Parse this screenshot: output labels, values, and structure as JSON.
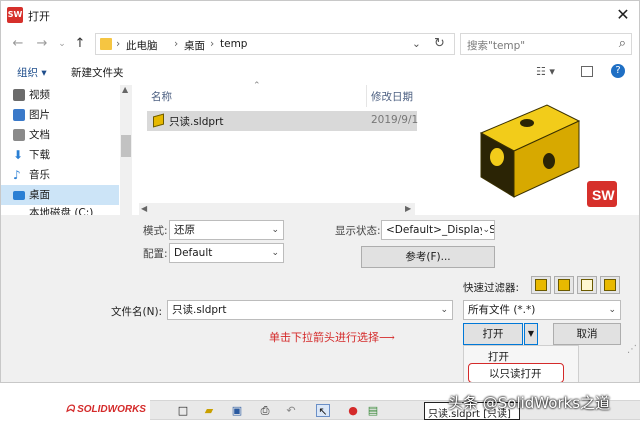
{
  "window": {
    "title": "打开",
    "app_icon": "SW"
  },
  "address": {
    "breadcrumb": [
      "此电脑",
      "桌面",
      "temp"
    ],
    "separator": "›"
  },
  "search": {
    "placeholder": "搜索\"temp\""
  },
  "toolbar": {
    "organize": "组织 ▾",
    "new_folder": "新建文件夹"
  },
  "sidebar": {
    "items": [
      {
        "label": "视频",
        "icon": "video-icon",
        "color": "#6b6b6b"
      },
      {
        "label": "图片",
        "icon": "pictures-icon",
        "color": "#3a79c9"
      },
      {
        "label": "文档",
        "icon": "documents-icon",
        "color": "#8a8a8a"
      },
      {
        "label": "下载",
        "icon": "download-icon",
        "color": "#2a7fd4"
      },
      {
        "label": "音乐",
        "icon": "music-icon",
        "color": "#2a7fd4"
      },
      {
        "label": "桌面",
        "icon": "desktop-icon",
        "color": "#2a7fd4"
      },
      {
        "label": "本地磁盘 (C:)",
        "icon": "drive-icon",
        "color": "#777777"
      }
    ],
    "selected": "桌面"
  },
  "file_list": {
    "columns": {
      "name": "名称",
      "date": "修改日期"
    },
    "rows": [
      {
        "name": "只读.sldprt",
        "date": "2019/9/1"
      }
    ]
  },
  "options": {
    "mode_label": "模式:",
    "mode_value": "还原",
    "config_label": "配置:",
    "config_value": "Default",
    "display_label": "显示状态:",
    "display_value": "<Default>_Display S",
    "references_button": "参考(F)...",
    "quick_filter_label": "快速过滤器:"
  },
  "filename": {
    "label": "文件名(N):",
    "value": "只读.sldprt",
    "type_value": "所有文件 (*.*)"
  },
  "buttons": {
    "open": "打开",
    "cancel": "取消"
  },
  "dropdown_menu": {
    "items": [
      "打开",
      "以只读打开"
    ]
  },
  "annotation": {
    "text": "单击下拉箭头进行选择",
    "color": "#d42a2a"
  },
  "sw_toolbar": {
    "logo": "SOLIDWORKS",
    "readonly_label": "只读.sldprt [只读]"
  },
  "watermark": "头条 @SolidWorks之道",
  "colors": {
    "selection": "#cce4f7",
    "part": "#e6b800",
    "accent": "#d42a2a"
  }
}
